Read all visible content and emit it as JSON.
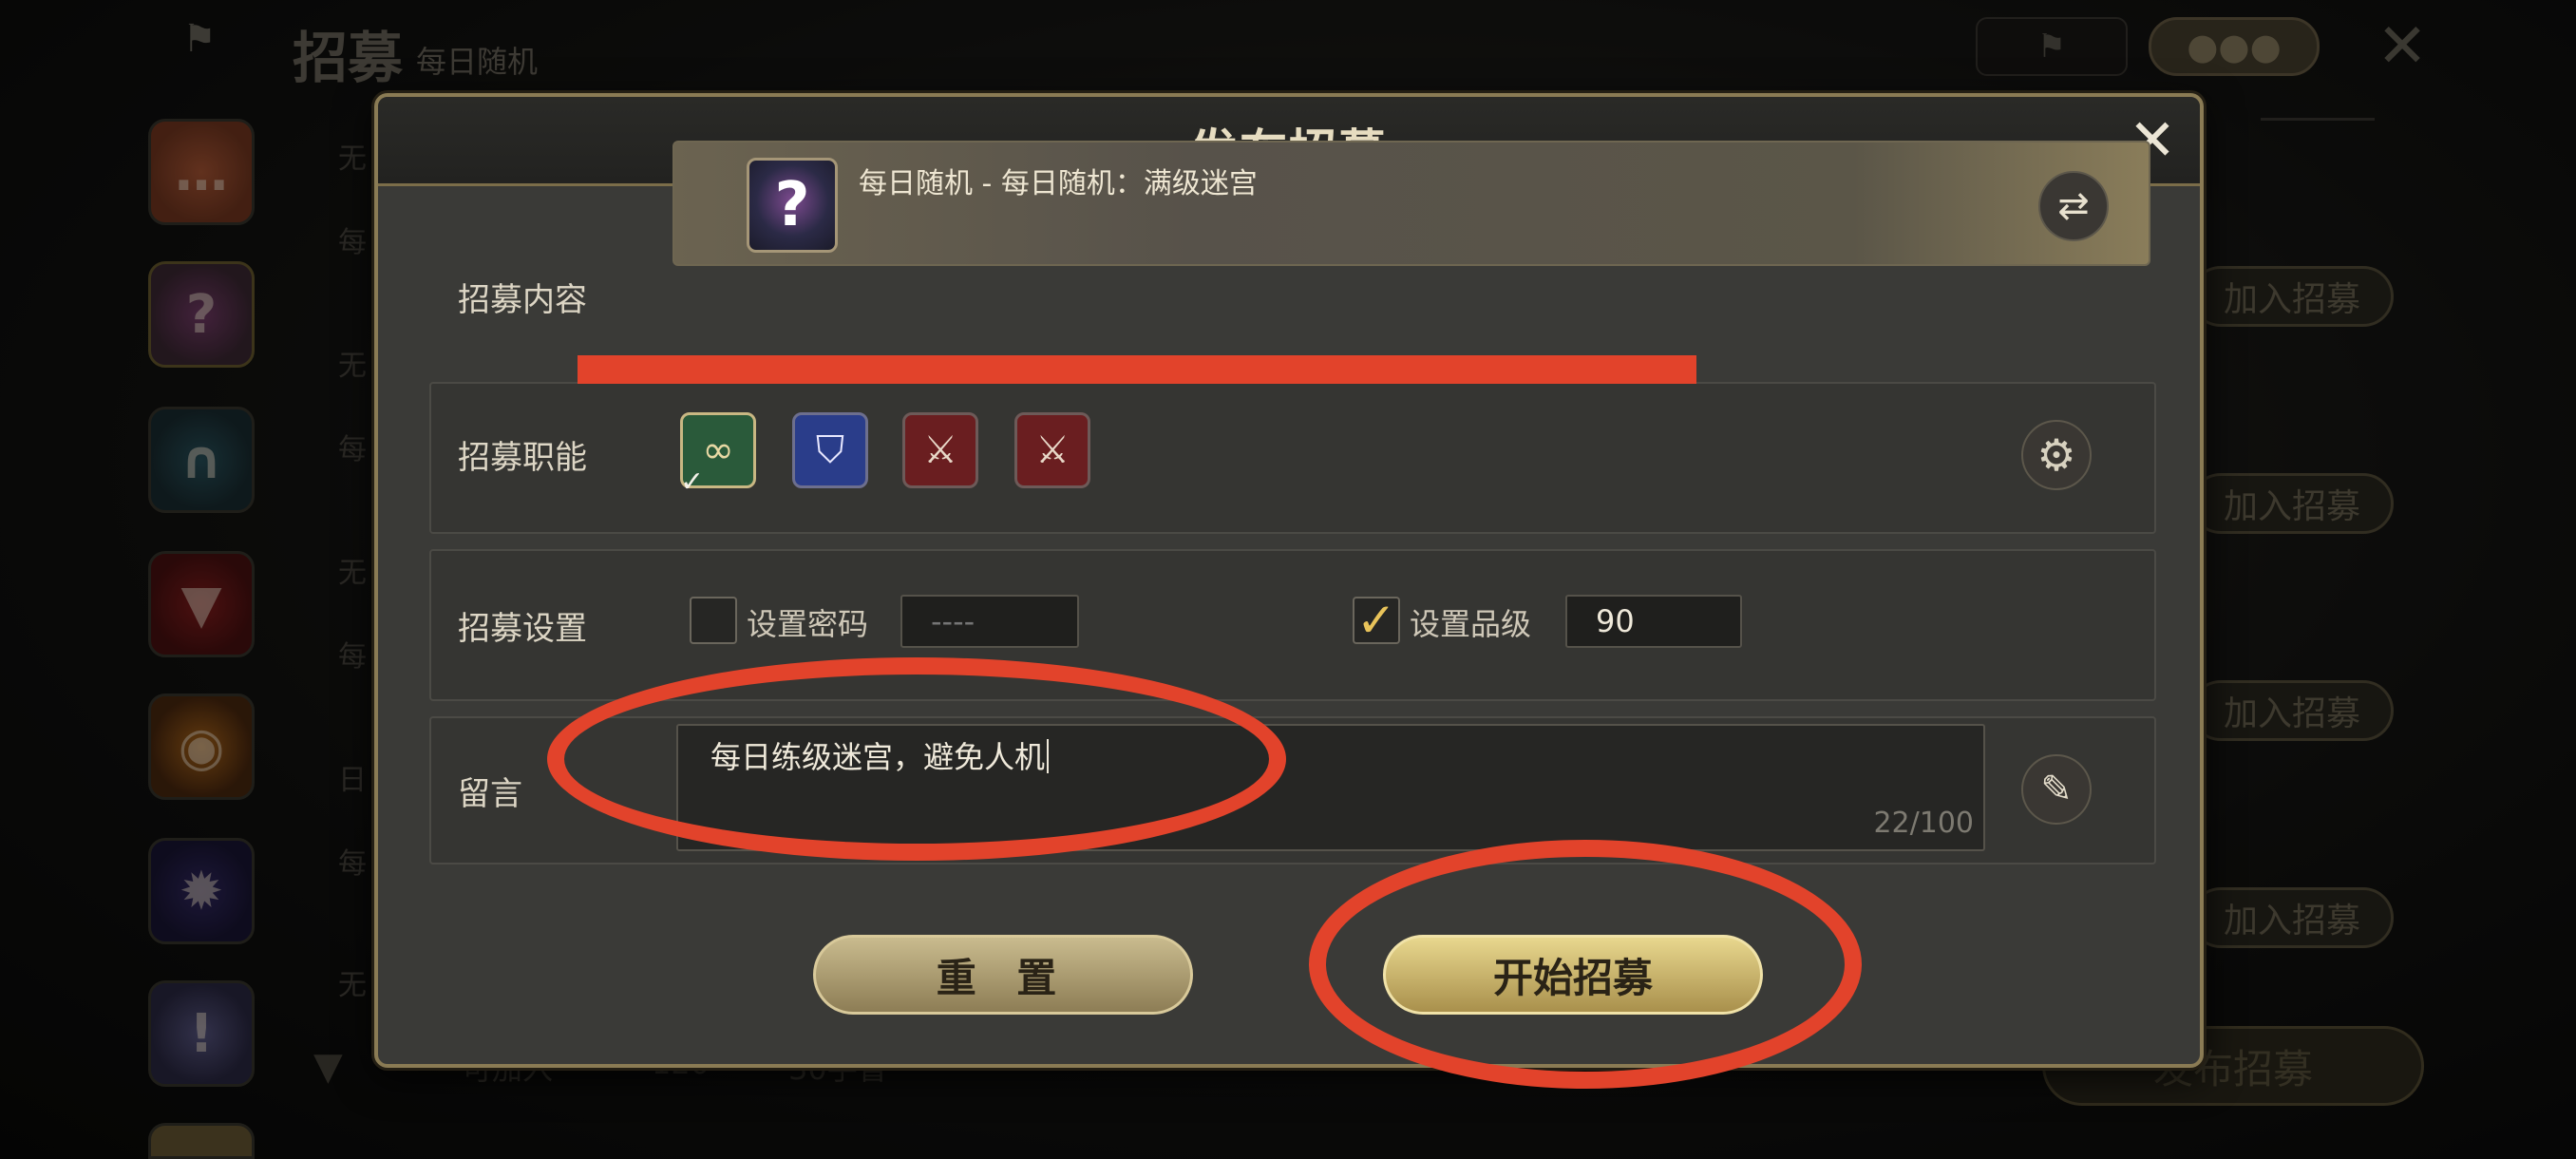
{
  "background": {
    "title": "招募",
    "subtitle": "每日随机",
    "join_label": "加入招募",
    "publish_label": "发布招募",
    "footer_items": [
      "可加入",
      "120",
      "30手冒"
    ],
    "row_letters": [
      "无",
      "每",
      "无",
      "每",
      "无",
      "每",
      "日",
      "每",
      "无"
    ]
  },
  "modal": {
    "title": "发布招募",
    "content": {
      "label": "招募内容",
      "value": "每日随机 - 每日随机：满级迷宫",
      "icon": "question-icon"
    },
    "roles": {
      "label": "招募职能",
      "icons": [
        "healer-icon",
        "shield-icon",
        "sword-icon",
        "sword-icon"
      ],
      "selected": 0
    },
    "settings": {
      "label": "招募设置",
      "password": {
        "label": "设置密码",
        "checked": false,
        "placeholder": "----"
      },
      "level": {
        "label": "设置品级",
        "checked": true,
        "value": "90"
      }
    },
    "message": {
      "label": "留言",
      "text": "每日练级迷宫，避免人机",
      "count": "22/100"
    },
    "buttons": {
      "reset": "重 置",
      "start": "开始招募"
    }
  },
  "colors": {
    "accent_gold": "#c9b783",
    "annotation_red": "#e2432b"
  }
}
